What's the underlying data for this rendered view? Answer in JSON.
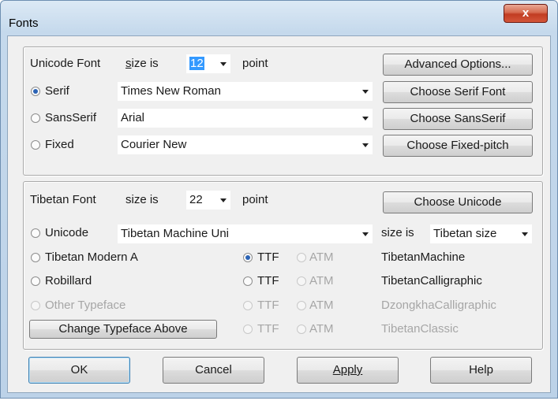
{
  "window": {
    "title": "Fonts",
    "close_glyph": "x"
  },
  "unicode": {
    "label": "Unicode Font",
    "size_label": "size is",
    "size_value": "12",
    "point_label": "point",
    "serif_label": "Serif",
    "serif_value": "Times New Roman",
    "sans_label": "SansSerif",
    "sans_value": "Arial",
    "fixed_label": "Fixed",
    "fixed_value": "Courier New",
    "advanced_button": "Advanced Options...",
    "choose_serif_button": "Choose Serif Font",
    "choose_sans_button": "Choose SansSerif",
    "choose_fixed_button": "Choose Fixed-pitch"
  },
  "tibetan": {
    "label": "Tibetan Font",
    "size_label": "size is",
    "size_value": "22",
    "point_label": "point",
    "choose_unicode_button": "Choose Unicode",
    "unicode_label": "Unicode",
    "unicode_value": "Tibetan Machine Uni",
    "size_is2_label": "size is",
    "size_is2_value": "Tibetan size",
    "modern_label": "Tibetan Modern A",
    "robillard_label": "Robillard",
    "other_label": "Other Typeface",
    "change_button": "Change Typeface Above",
    "ttf_label": "TTF",
    "atm_label": "ATM",
    "font_names": [
      "TibetanMachine",
      "TibetanCalligraphic",
      "DzongkhaCalligraphic",
      "TibetanClassic"
    ]
  },
  "footer": {
    "ok": "OK",
    "cancel": "Cancel",
    "apply": "Apply",
    "help": "Help"
  }
}
